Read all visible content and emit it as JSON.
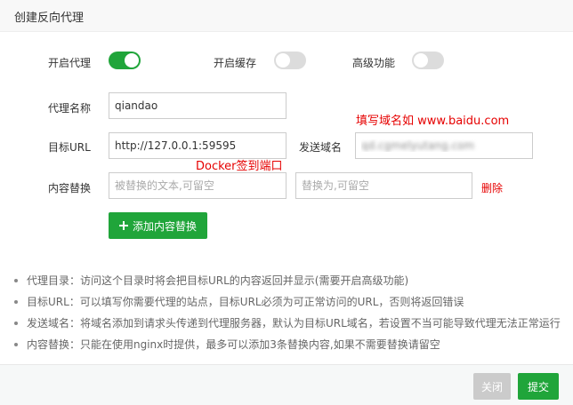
{
  "dialog": {
    "title": "创建反向代理"
  },
  "toggles": {
    "proxy": {
      "label": "开启代理",
      "state": "on"
    },
    "cache": {
      "label": "开启缓存",
      "state": "off"
    },
    "advanced": {
      "label": "高级功能",
      "state": "off"
    }
  },
  "fields": {
    "proxy_name": {
      "label": "代理名称",
      "value": "qiandao"
    },
    "target_url": {
      "label": "目标URL",
      "value": "http://127.0.0.1:59595"
    },
    "send_domain": {
      "label": "发送域名",
      "value": "qd.cgmelyutang.com"
    },
    "content_replace": {
      "label": "内容替换",
      "from_placeholder": "被替换的文本,可留空",
      "to_placeholder": "替换为,可留空",
      "delete_label": "删除"
    }
  },
  "annotations": {
    "domain_hint": "填写域名如 www.baidu.com",
    "port_hint": "Docker签到端口"
  },
  "add_replace_button": {
    "label": "添加内容替换"
  },
  "notes": [
    "代理目录：访问这个目录时将会把目标URL的内容返回并显示(需要开启高级功能)",
    "目标URL：可以填写你需要代理的站点，目标URL必须为可正常访问的URL，否则将返回错误",
    "发送域名：将域名添加到请求头传递到代理服务器，默认为目标URL域名，若设置不当可能导致代理无法正常运行",
    "内容替换：只能在使用nginx时提供，最多可以添加3条替换内容,如果不需要替换请留空"
  ],
  "footer": {
    "close_label": "关闭",
    "submit_label": "提交"
  },
  "colors": {
    "accent": "#20a53a",
    "annotation": "#e60000",
    "disabled": "#cbcbcb"
  }
}
